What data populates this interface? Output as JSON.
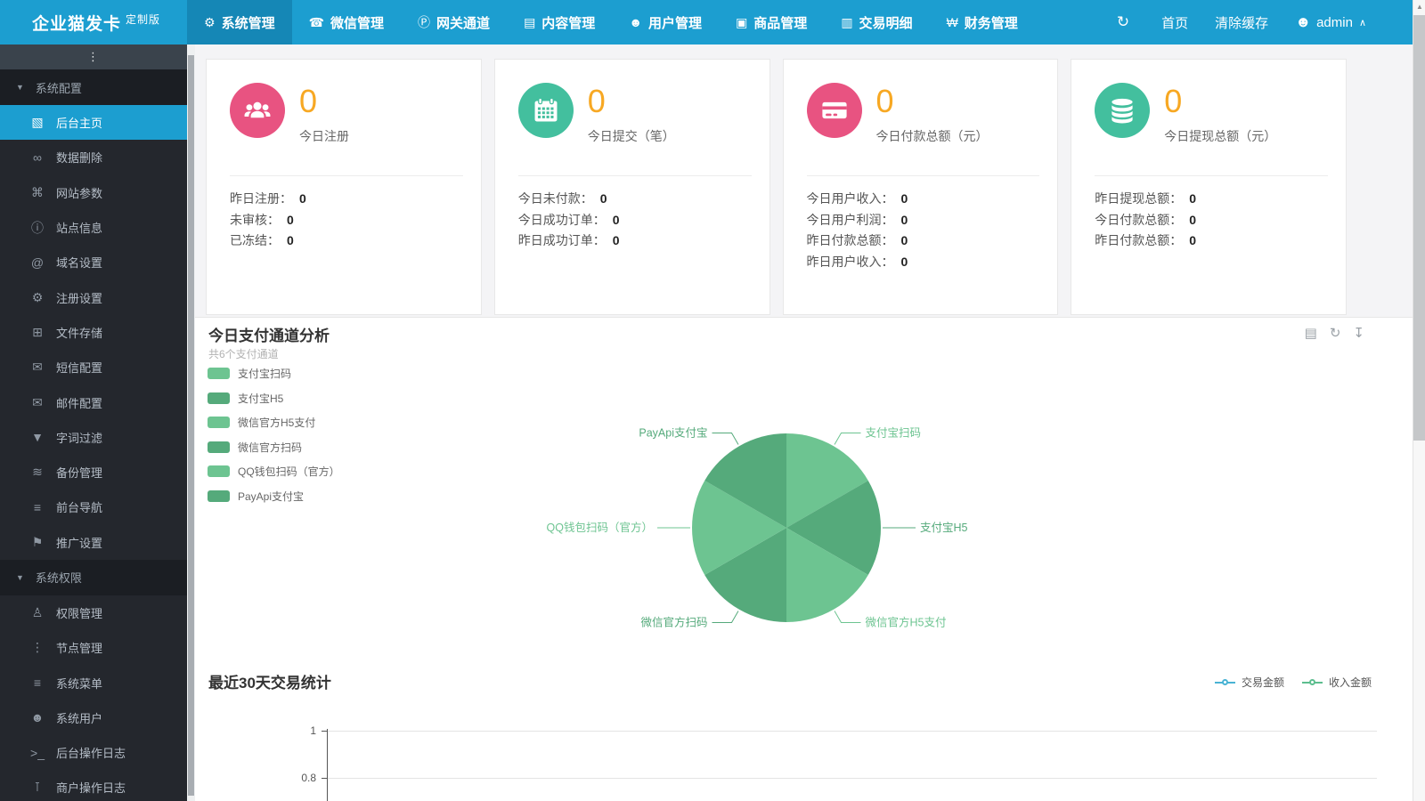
{
  "colors": {
    "accent": "#1c9ed0",
    "navbar": "#1c9ed0",
    "nav_active": "#1587b6",
    "orange": "#f7a823",
    "pink": "#e85381",
    "teal": "#43bf9e",
    "pie_light_green": "#6dc491",
    "pie_dark_green": "#55aa7b"
  },
  "navbar": {
    "logo": "企业猫发卡",
    "logo_badge": "定制版",
    "items": [
      {
        "name": "system",
        "label": "系统管理",
        "icon": "gear-icon",
        "active": true
      },
      {
        "name": "wechat",
        "label": "微信管理",
        "icon": "wechat-icon",
        "active": false
      },
      {
        "name": "gateway",
        "label": "网关通道",
        "icon": "gateway-p-icon",
        "active": false
      },
      {
        "name": "content",
        "label": "内容管理",
        "icon": "document-icon",
        "active": false
      },
      {
        "name": "user",
        "label": "用户管理",
        "icon": "users-icon",
        "active": false
      },
      {
        "name": "goods",
        "label": "商品管理",
        "icon": "goods-icon",
        "active": false
      },
      {
        "name": "trade",
        "label": "交易明细",
        "icon": "bar-chart-icon",
        "active": false
      },
      {
        "name": "finance",
        "label": "财务管理",
        "icon": "finance-icon",
        "active": false
      }
    ],
    "right_items": [
      {
        "name": "refresh-button",
        "label": "",
        "icon": "refresh-icon"
      },
      {
        "name": "home-link",
        "label": "首页",
        "icon": ""
      },
      {
        "name": "clear-cache-link",
        "label": "清除缓存",
        "icon": ""
      },
      {
        "name": "user-menu",
        "label": "admin",
        "icon": "user-icon",
        "caret": "caret-up-icon"
      }
    ]
  },
  "sidebar": {
    "toggle_icon": "ellipsis-v-icon",
    "rows": [
      {
        "type": "section",
        "name": "system-config",
        "label": "系统配置",
        "icon": "caret-down-icon"
      },
      {
        "type": "item",
        "name": "backend-home",
        "label": "后台主页",
        "icon": "dashboard-chart-icon",
        "active": true
      },
      {
        "type": "item",
        "name": "data-delete",
        "label": "数据删除",
        "icon": "link-icon",
        "active": false
      },
      {
        "type": "item",
        "name": "site-params",
        "label": "网站参数",
        "icon": "apple-icon",
        "active": false
      },
      {
        "type": "item",
        "name": "site-info",
        "label": "站点信息",
        "icon": "info-icon",
        "active": false
      },
      {
        "type": "item",
        "name": "domain-settings",
        "label": "域名设置",
        "icon": "at-icon",
        "active": false
      },
      {
        "type": "item",
        "name": "register-settings",
        "label": "注册设置",
        "icon": "gear-icon",
        "active": false
      },
      {
        "type": "item",
        "name": "file-storage",
        "label": "文件存储",
        "icon": "floppy-icon",
        "active": false
      },
      {
        "type": "item",
        "name": "sms-config",
        "label": "短信配置",
        "icon": "envelope-icon",
        "active": false
      },
      {
        "type": "item",
        "name": "mail-config",
        "label": "邮件配置",
        "icon": "envelope-icon",
        "active": false
      },
      {
        "type": "item",
        "name": "word-filter",
        "label": "字词过滤",
        "icon": "filter-icon",
        "active": false
      },
      {
        "type": "item",
        "name": "backup-manage",
        "label": "备份管理",
        "icon": "database-icon",
        "active": false
      },
      {
        "type": "item",
        "name": "front-nav",
        "label": "前台导航",
        "icon": "bars-icon",
        "active": false
      },
      {
        "type": "item",
        "name": "promotion-settings",
        "label": "推广设置",
        "icon": "megaphone-icon",
        "active": false
      },
      {
        "type": "section",
        "name": "system-permission",
        "label": "系统权限",
        "icon": "caret-down-icon"
      },
      {
        "type": "item",
        "name": "permission-manage",
        "label": "权限管理",
        "icon": "user-lock-icon",
        "active": false
      },
      {
        "type": "item",
        "name": "node-manage",
        "label": "节点管理",
        "icon": "ellipsis-v-icon",
        "active": false
      },
      {
        "type": "item",
        "name": "system-menu",
        "label": "系统菜单",
        "icon": "bars-icon",
        "active": false
      },
      {
        "type": "item",
        "name": "system-user",
        "label": "系统用户",
        "icon": "users-icon",
        "active": false
      },
      {
        "type": "item",
        "name": "backend-op-log",
        "label": "后台操作日志",
        "icon": "terminal-icon",
        "active": false
      },
      {
        "type": "item",
        "name": "merchant-op-log",
        "label": "商户操作日志",
        "icon": "log-icon",
        "active": false
      }
    ]
  },
  "cards": [
    {
      "name": "card-today-register",
      "icon": "users-icon",
      "icon_bg": "#e85381",
      "big_value": "0",
      "title": "今日注册",
      "rows": [
        {
          "label": "昨日注册：",
          "value": "0"
        },
        {
          "label": "未审核：",
          "value": "0"
        },
        {
          "label": "已冻结：",
          "value": "0"
        }
      ]
    },
    {
      "name": "card-today-orders",
      "icon": "calendar-icon",
      "icon_bg": "#43bf9e",
      "big_value": "0",
      "title": "今日提交（笔）",
      "rows": [
        {
          "label": "今日未付款：",
          "value": "0"
        },
        {
          "label": "今日成功订单：",
          "value": "0"
        },
        {
          "label": "昨日成功订单：",
          "value": "0"
        }
      ]
    },
    {
      "name": "card-today-payment",
      "icon": "credit-card-icon",
      "icon_bg": "#e85381",
      "big_value": "0",
      "title": "今日付款总额（元）",
      "rows": [
        {
          "label": "今日用户收入：",
          "value": "0"
        },
        {
          "label": "今日用户利润：",
          "value": "0"
        },
        {
          "label": "昨日付款总额：",
          "value": "0"
        },
        {
          "label": "昨日用户收入：",
          "value": "0"
        }
      ]
    },
    {
      "name": "card-today-withdraw",
      "icon": "database-icon",
      "icon_bg": "#43bf9e",
      "big_value": "0",
      "title": "今日提现总额（元）",
      "rows": [
        {
          "label": "昨日提现总额：",
          "value": "0"
        },
        {
          "label": "今日付款总额：",
          "value": "0"
        },
        {
          "label": "昨日付款总额：",
          "value": "0"
        }
      ]
    }
  ],
  "pie_section": {
    "title": "今日支付通道分析",
    "subtitle": "共6个支付通道",
    "toolbox": [
      {
        "name": "data-view-button",
        "icon": "data-view-icon"
      },
      {
        "name": "refresh-button",
        "icon": "refresh-icon"
      },
      {
        "name": "download-button",
        "icon": "download-icon"
      }
    ]
  },
  "line_section": {
    "title": "最近30天交易统计",
    "legend": [
      {
        "label": "交易金额",
        "color": "#49b3d4"
      },
      {
        "label": "收入金额",
        "color": "#5dbe8f"
      }
    ],
    "yticks": [
      "1",
      "0.8"
    ]
  },
  "chart_data": [
    {
      "type": "pie",
      "title": "今日支付通道分析",
      "subtitle": "共6个支付通道",
      "categories": [
        "支付宝扫码",
        "支付宝H5",
        "微信官方H5支付",
        "微信官方扫码",
        "QQ钱包扫码（官方）",
        "PayApi支付宝"
      ],
      "values": [
        1,
        1,
        1,
        1,
        1,
        1
      ],
      "colors": [
        "#6dc491",
        "#55aa7b",
        "#6dc491",
        "#55aa7b",
        "#6dc491",
        "#55aa7b"
      ],
      "legend_position": "left",
      "note": "6 equal slices, labels on leader lines, clockwise from top"
    },
    {
      "type": "line",
      "title": "最近30天交易统计",
      "x_count": 30,
      "series": [
        {
          "name": "交易金额",
          "color": "#49b3d4",
          "values": []
        },
        {
          "name": "收入金额",
          "color": "#5dbe8f",
          "values": []
        }
      ],
      "visible_yticks": [
        1,
        0.8
      ],
      "legend_position": "top-right",
      "note": "chart area cut off at bottom of screenshot; no data points visible"
    }
  ]
}
